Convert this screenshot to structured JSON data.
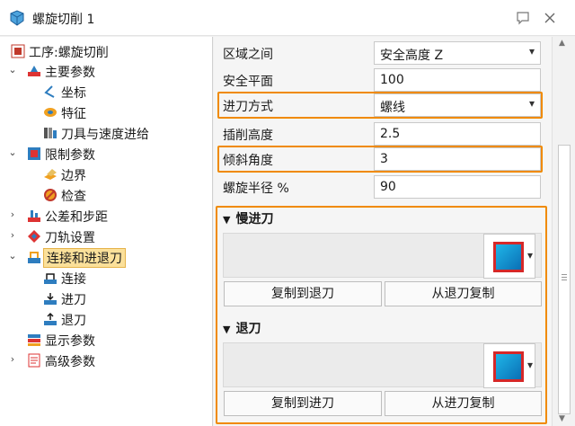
{
  "window": {
    "title": "螺旋切削 1"
  },
  "tree": {
    "items": [
      {
        "label": "工序:螺旋切削"
      },
      {
        "label": "主要参数"
      },
      {
        "label": "坐标"
      },
      {
        "label": "特征"
      },
      {
        "label": "刀具与速度进给"
      },
      {
        "label": "限制参数"
      },
      {
        "label": "边界"
      },
      {
        "label": "检查"
      },
      {
        "label": "公差和步距"
      },
      {
        "label": "刀轨设置"
      },
      {
        "label": "连接和进退刀"
      },
      {
        "label": "连接"
      },
      {
        "label": "进刀"
      },
      {
        "label": "退刀"
      },
      {
        "label": "显示参数"
      },
      {
        "label": "高级参数"
      }
    ]
  },
  "form": {
    "region_label": "区域之间",
    "region_value": "安全高度 Z",
    "safe_plane_label": "安全平面",
    "safe_plane_value": "100",
    "engage_mode_label": "进刀方式",
    "engage_mode_value": "螺线",
    "plunge_height_label": "插削高度",
    "plunge_height_value": "2.5",
    "ramp_angle_label": "倾斜角度",
    "ramp_angle_value": "3",
    "helix_radius_label": "螺旋半径 %",
    "helix_radius_value": "90"
  },
  "slow_engage": {
    "title": "慢进刀",
    "copy_to_label": "复制到退刀",
    "copy_from_label": "从退刀复制"
  },
  "retract": {
    "title": "退刀",
    "copy_to_label": "复制到进刀",
    "copy_from_label": "从进刀复制"
  },
  "colors": {
    "highlight": "#f08a00",
    "selection": "#fbe09a",
    "swatch": "#1fb6e8"
  }
}
